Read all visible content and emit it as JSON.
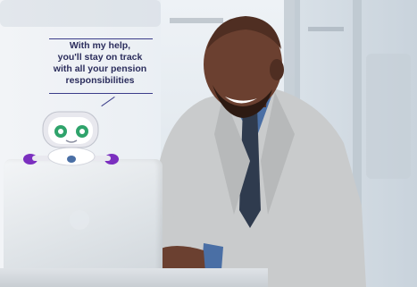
{
  "speech": {
    "line1": "With my help,",
    "line2": "you'll stay on track",
    "line3": "with all your pension",
    "line4": "responsibilities"
  },
  "colors": {
    "speech_text": "#2b2d5c",
    "robot_eye": "#2fa36b",
    "robot_accent": "#7b2fbf",
    "suit": "#c9cbcc"
  },
  "icons": {
    "robot": "robot-mascot-icon"
  }
}
